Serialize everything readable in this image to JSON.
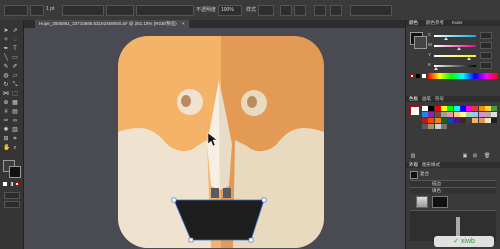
{
  "document_tab": {
    "title": "Hope_3005861_33710695.53192469000.ai* @ 251.18% (RGB/预览)",
    "close": "×"
  },
  "control_bar": {
    "zoom_value": "1 pt",
    "opacity_label": "不透明度",
    "opacity_value": "100%",
    "style_label": "样式"
  },
  "panels": {
    "color_tabs": [
      "颜色",
      "颜色参考",
      "Kuler"
    ],
    "channels": [
      {
        "label": "C",
        "level": 0.26
      },
      {
        "label": "M",
        "level": 0.55
      },
      {
        "label": "Y",
        "level": 0.82
      },
      {
        "label": "K",
        "level": 0.05
      }
    ],
    "swatch_tabs": [
      "色板",
      "画笔",
      "符号"
    ],
    "appearance_tabs": [
      "外观",
      "图形样式"
    ],
    "appearance_title": "复合",
    "appearance_rows": [
      "描边",
      "填色"
    ]
  },
  "colors": {
    "face_top_left": "#f5b36a",
    "face_top_right": "#e29a55",
    "face_lower": "#efe3cf",
    "mouth": "#1e1e1e",
    "canvas": "#4a4a52"
  },
  "watermark": {
    "text": "✓ xiwb"
  }
}
